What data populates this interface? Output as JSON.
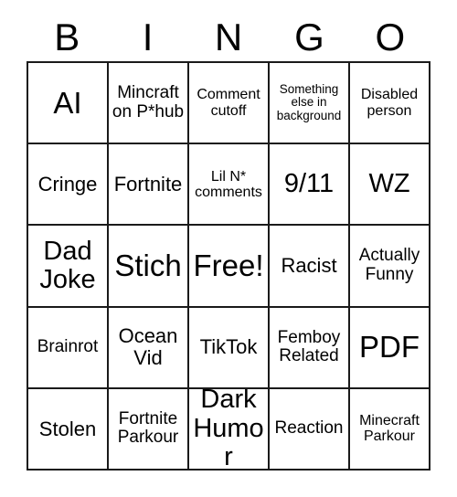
{
  "header": {
    "letters": [
      "B",
      "I",
      "N",
      "G",
      "O"
    ]
  },
  "grid": {
    "rows": 5,
    "columns": 5,
    "border_color": "#1a1a1a",
    "background_color": "#ffffff",
    "text_color": "#000000",
    "cells": [
      {
        "text": "AI",
        "size": "xl"
      },
      {
        "text": "Mincraft on P*hub",
        "size": "sm"
      },
      {
        "text": "Comment cutoff",
        "size": "xs"
      },
      {
        "text": "Something else in background",
        "size": "xxs"
      },
      {
        "text": "Disabled person",
        "size": "xs"
      },
      {
        "text": "Cringe",
        "size": "md"
      },
      {
        "text": "Fortnite",
        "size": "md"
      },
      {
        "text": "Lil N* comments",
        "size": "xs"
      },
      {
        "text": "9/11",
        "size": "lg"
      },
      {
        "text": "WZ",
        "size": "lg"
      },
      {
        "text": "Dad Joke",
        "size": "lg"
      },
      {
        "text": "Stich",
        "size": "xl"
      },
      {
        "text": "Free!",
        "size": "xl"
      },
      {
        "text": "Racist",
        "size": "md"
      },
      {
        "text": "Actually Funny",
        "size": "sm"
      },
      {
        "text": "Brainrot",
        "size": "sm"
      },
      {
        "text": "Ocean Vid",
        "size": "md"
      },
      {
        "text": "TikTok",
        "size": "md"
      },
      {
        "text": "Femboy Related",
        "size": "sm"
      },
      {
        "text": "PDF",
        "size": "xl"
      },
      {
        "text": "Stolen",
        "size": "md"
      },
      {
        "text": "Fortnite Parkour",
        "size": "sm"
      },
      {
        "text": "Dark Humor",
        "size": "lg"
      },
      {
        "text": "Reaction",
        "size": "sm"
      },
      {
        "text": "Minecraft Parkour",
        "size": "xs"
      }
    ]
  }
}
